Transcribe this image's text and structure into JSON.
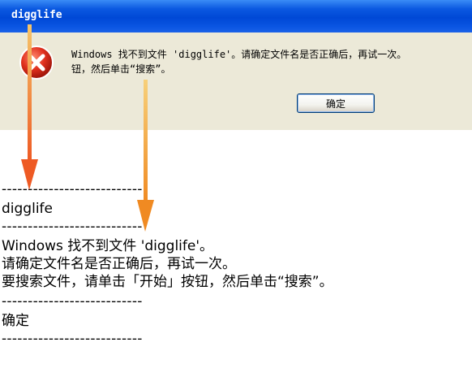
{
  "dialog": {
    "title": "digglife",
    "message_line1": "Windows 找不到文件 'digglife'。请确定文件名是否正确后，再试一次。",
    "message_line2": "钮，然后单击“搜索”。",
    "ok_button_label": "确定",
    "icon": "error-x-icon"
  },
  "copied_text": {
    "separator": "---------------------------",
    "title": "digglife",
    "message_lines": [
      "Windows 找不到文件 'digglife'。",
      "请确定文件名是否正确后，再试一次。",
      "要搜索文件，请单击「开始」按钮，然后单击“搜索”。"
    ],
    "button_label": "确定"
  },
  "colors": {
    "titlebar": "#0A55E2",
    "dialog_bg": "#ECE9D8",
    "arrow": "#F2872C"
  }
}
